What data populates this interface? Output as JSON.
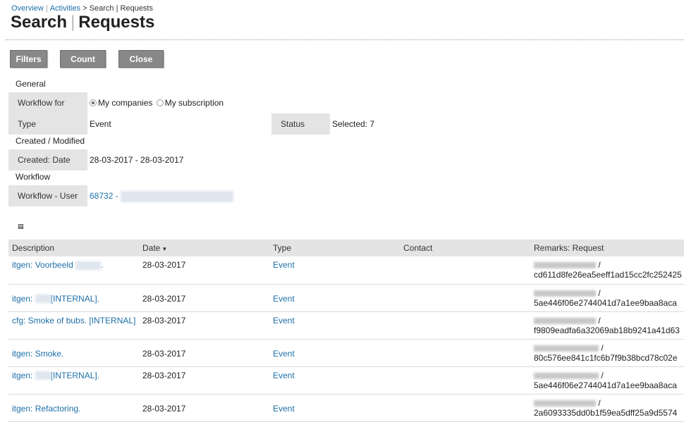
{
  "breadcrumb": {
    "overview": "Overview",
    "activities": "Activities",
    "search": "Search",
    "requests": "Requests",
    "sep1": "|",
    "sep2": ">",
    "sep3": "|"
  },
  "title": {
    "left": "Search",
    "separator": "|",
    "right": "Requests"
  },
  "buttons": {
    "filters": "Filters",
    "count": "Count",
    "close": "Close"
  },
  "filters": {
    "general_label": "General",
    "workflow_for_label": "Workflow for",
    "workflow_for_options": [
      "My companies",
      "My subscription"
    ],
    "type_label": "Type",
    "type_value": "Event",
    "status_label": "Status",
    "status_value": "Selected: 7",
    "created_modified_label": "Created / Modified",
    "created_date_label": "Created: Date",
    "created_date_value": "28-03-2017 - 28-03-2017",
    "workflow_label": "Workflow",
    "workflow_user_label": "Workflow - User",
    "workflow_user_value": "68732 -"
  },
  "table": {
    "headers": [
      "Description",
      "Date",
      "Type",
      "Contact",
      "Remarks: Request"
    ],
    "rows": [
      {
        "description": "itgen: Voorbeeld",
        "description_suffix": ".",
        "date": "28-03-2017",
        "type": "Event",
        "contact": "",
        "remark_line1": "/",
        "remark_line2": "cd611d8fe26ea5eeff1ad15cc2fc252425"
      },
      {
        "description": "itgen:",
        "description_suffix": "[INTERNAL].",
        "date": "28-03-2017",
        "type": "Event",
        "contact": "",
        "remark_line1": "/",
        "remark_line2": "5ae446f06e2744041d7a1ee9baa8aca"
      },
      {
        "description": "cfg: Smoke of bubs. [INTERNAL]",
        "description_suffix": "",
        "date": "28-03-2017",
        "type": "Event",
        "contact": "",
        "remark_line1": "/",
        "remark_line2": "f9809eadfa6a32069ab18b9241a41d63"
      },
      {
        "description": "itgen: Smoke.",
        "description_suffix": "",
        "date": "28-03-2017",
        "type": "Event",
        "contact": "",
        "remark_line1": "/",
        "remark_line2": "80c576ee841c1fc6b7f9b38bcd78c02e"
      },
      {
        "description": "itgen:",
        "description_suffix": "[INTERNAL].",
        "date": "28-03-2017",
        "type": "Event",
        "contact": "",
        "remark_line1": "/",
        "remark_line2": "5ae446f06e2744041d7a1ee9baa8aca"
      },
      {
        "description": "itgen: Refactoring.",
        "description_suffix": "",
        "date": "28-03-2017",
        "type": "Event",
        "contact": "",
        "remark_line1": "/",
        "remark_line2": "2a6093335dd0b1f59ea5dff25a9d5574"
      }
    ]
  },
  "icons": {
    "sort": "caret-down-icon",
    "table_toggle": "small-table-icon"
  },
  "colors": {
    "link": "#1d6fa8",
    "button_bg": "#888888",
    "label_bg": "#e4e4e4"
  }
}
